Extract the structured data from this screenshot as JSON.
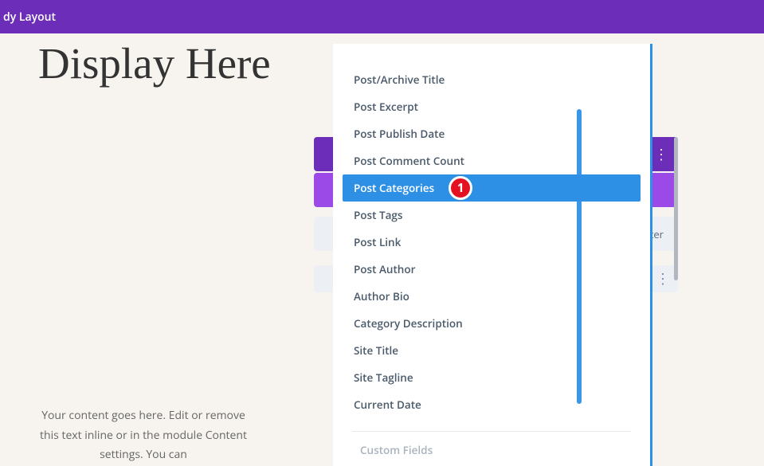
{
  "topbar": {
    "title": "dy Layout"
  },
  "heading": "Display Here",
  "content_text": "Your content goes here. Edit or remove this text inline or in the module Content settings. You can",
  "builder": {
    "gray_label_suffix": "ter"
  },
  "dropdown": {
    "items": [
      {
        "label": "Post/Archive Title",
        "selected": false
      },
      {
        "label": "Post Excerpt",
        "selected": false
      },
      {
        "label": "Post Publish Date",
        "selected": false
      },
      {
        "label": "Post Comment Count",
        "selected": false
      },
      {
        "label": "Post Categories",
        "selected": true
      },
      {
        "label": "Post Tags",
        "selected": false
      },
      {
        "label": "Post Link",
        "selected": false
      },
      {
        "label": "Post Author",
        "selected": false
      },
      {
        "label": "Author Bio",
        "selected": false
      },
      {
        "label": "Category Description",
        "selected": false
      },
      {
        "label": "Site Title",
        "selected": false
      },
      {
        "label": "Site Tagline",
        "selected": false
      },
      {
        "label": "Current Date",
        "selected": false
      }
    ],
    "section_label": "Custom Fields",
    "callout_number": "1"
  }
}
